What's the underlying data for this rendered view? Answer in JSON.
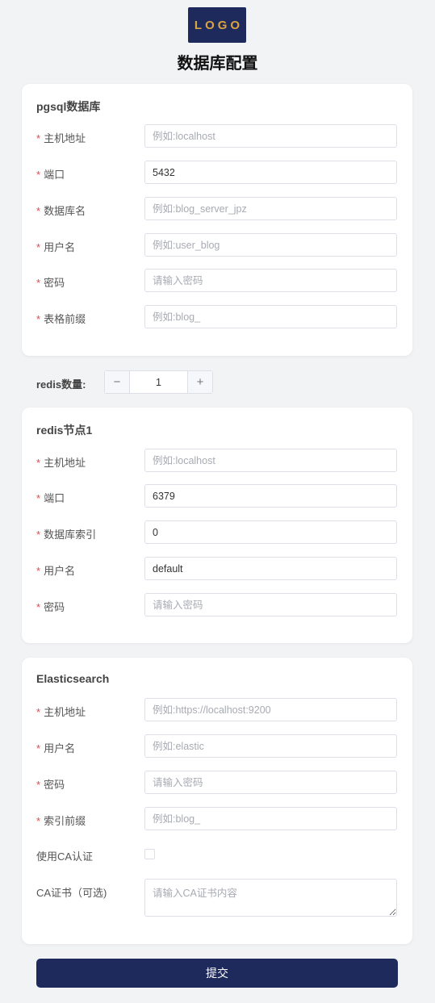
{
  "logo": {
    "text": "LOGO"
  },
  "page": {
    "title": "数据库配置"
  },
  "pgsql": {
    "title": "pgsql数据库",
    "fields": [
      {
        "label": "主机地址",
        "value": "",
        "placeholder": "例如:localhost"
      },
      {
        "label": "端口",
        "value": "5432",
        "placeholder": ""
      },
      {
        "label": "数据库名",
        "value": "",
        "placeholder": "例如:blog_server_jpz"
      },
      {
        "label": "用户名",
        "value": "",
        "placeholder": "例如:user_blog"
      },
      {
        "label": "密码",
        "value": "",
        "placeholder": "请输入密码"
      },
      {
        "label": "表格前缀",
        "value": "",
        "placeholder": "例如:blog_"
      }
    ]
  },
  "redis_count": {
    "label": "redis数量:",
    "value": "1",
    "minus": "−",
    "plus": "+"
  },
  "redis": {
    "title": "redis节点1",
    "fields": [
      {
        "label": "主机地址",
        "value": "",
        "placeholder": "例如:localhost"
      },
      {
        "label": "端口",
        "value": "6379",
        "placeholder": ""
      },
      {
        "label": "数据库索引",
        "value": "0",
        "placeholder": ""
      },
      {
        "label": "用户名",
        "value": "default",
        "placeholder": ""
      },
      {
        "label": "密码",
        "value": "",
        "placeholder": "请输入密码"
      }
    ]
  },
  "es": {
    "title": "Elasticsearch",
    "fields": [
      {
        "label": "主机地址",
        "value": "",
        "placeholder": "例如:https://localhost:9200"
      },
      {
        "label": "用户名",
        "value": "",
        "placeholder": "例如:elastic"
      },
      {
        "label": "密码",
        "value": "",
        "placeholder": "请输入密码"
      },
      {
        "label": "索引前缀",
        "value": "",
        "placeholder": "例如:blog_"
      }
    ],
    "ca_label": "使用CA认证",
    "cert_label": "CA证书（可选)",
    "cert_placeholder": "请输入CA证书内容"
  },
  "required_mark": "*",
  "submit": {
    "label": "提交"
  },
  "colors": {
    "brand": "#1f2a5c",
    "logo_text": "#d9a441",
    "required": "#e04a4a",
    "background": "#f2f3f5"
  }
}
